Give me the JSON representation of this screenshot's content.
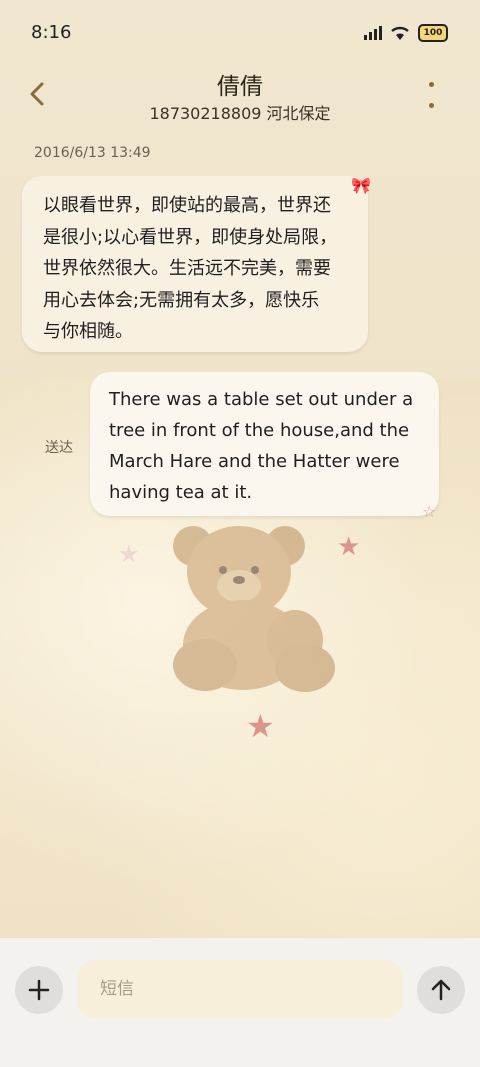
{
  "status_bar": {
    "time": "8:16",
    "battery": "100"
  },
  "header": {
    "contact_name": "倩倩",
    "contact_sub": "18730218809 河北保定"
  },
  "conversation": {
    "timestamp": "2016/6/13 13:49",
    "incoming": [
      "以眼看世界，即使站的最高，世界还",
      "是很小;以心看世界，即使身处局限，",
      "世界依然很大。生活远不完美，需要",
      "用心去体会;无需拥有太多，愿快乐",
      "与你相随。"
    ],
    "outgoing": [
      "There was a table set out under a",
      "tree in front of the house,and the",
      "March Hare and the Hatter were",
      "having tea at it."
    ],
    "delivered_label": "送达"
  },
  "composer": {
    "placeholder": "短信"
  },
  "colors": {
    "accent": "#8a6a3a",
    "bubble_in": "#f8f1e2",
    "bubble_out": "#fbf7ef",
    "star": "#d9968f"
  }
}
